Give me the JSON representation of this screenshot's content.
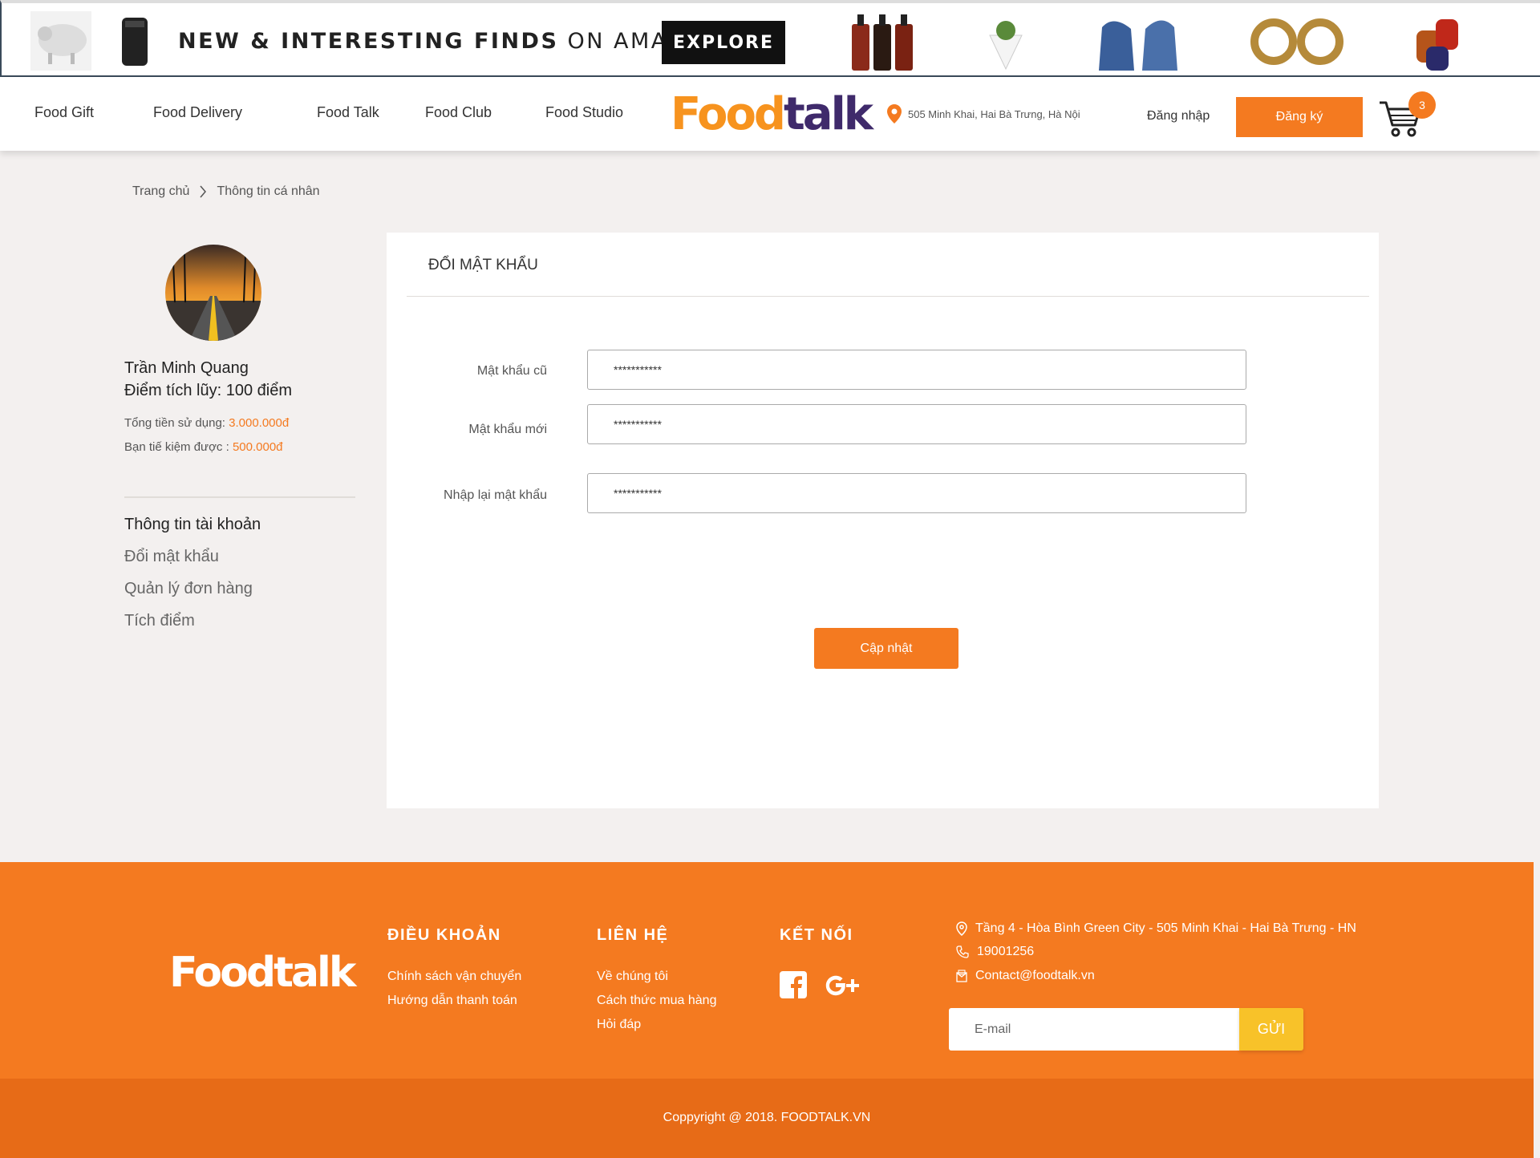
{
  "ad": {
    "headline_bold": "NEW & INTERESTING FINDS",
    "headline_rest": " ON AMAZON",
    "cta": "EXPLORE"
  },
  "nav": {
    "items": [
      {
        "label": "Food Gift"
      },
      {
        "label": "Food Delivery"
      },
      {
        "label": "Food Talk"
      },
      {
        "label": "Food Club"
      },
      {
        "label": "Food Studio"
      }
    ],
    "logo_food": "Food",
    "logo_talk": "talk",
    "address": "505 Minh Khai, Hai Bà Trưng, Hà Nội",
    "login": "Đăng nhập",
    "signup": "Đăng ký",
    "cart_count": "3"
  },
  "breadcrumb": {
    "home": "Trang chủ",
    "current": "Thông tin cá nhân"
  },
  "profile": {
    "name": "Trần Minh Quang",
    "points": "Điểm tích lũy: 100 điểm",
    "spent_label": "Tổng tiền sử dụng: ",
    "spent_value": "3.000.000đ",
    "saved_label": "Bạn tiế kiệm được : ",
    "saved_value": "500.000đ"
  },
  "sidebar": {
    "links": [
      {
        "label": "Thông tin tài khoản"
      },
      {
        "label": "Đổi mật khẩu"
      },
      {
        "label": "Quản lý đơn hàng"
      },
      {
        "label": "Tích điểm"
      }
    ]
  },
  "form": {
    "title": "ĐỔI MẬT KHẨU",
    "old_label": "Mật khẩu cũ",
    "old_value": "***********",
    "new_label": "Mật khẩu mới",
    "new_value": "***********",
    "confirm_label": "Nhập lại mật khẩu",
    "confirm_value": "***********",
    "submit": "Cập nhật"
  },
  "footer": {
    "logo_food": "Food",
    "logo_talk": "talk",
    "terms_heading": "ĐIỀU KHOẢN",
    "terms_links": [
      {
        "label": "Chính sách vận chuyển"
      },
      {
        "label": "Hướng dẫn thanh toán"
      }
    ],
    "contact_heading": "LIÊN HỆ",
    "contact_links": [
      {
        "label": "Về chúng tôi"
      },
      {
        "label": "Cách thức mua hàng"
      },
      {
        "label": "Hỏi đáp"
      }
    ],
    "connect_heading": "KẾT NỐI",
    "address": "Tầng 4 - Hòa Bình Green City - 505 Minh Khai - Hai Bà Trưng - HN",
    "phone": "19001256",
    "email": "Contact@foodtalk.vn",
    "email_placeholder": "E-mail",
    "send": "GỬI",
    "copyright": "Coppyright @ 2018. FOODTALK.VN"
  },
  "colors": {
    "accent": "#f47a20",
    "send_button": "#f8c229",
    "logo_purple": "#3f2a6b"
  }
}
